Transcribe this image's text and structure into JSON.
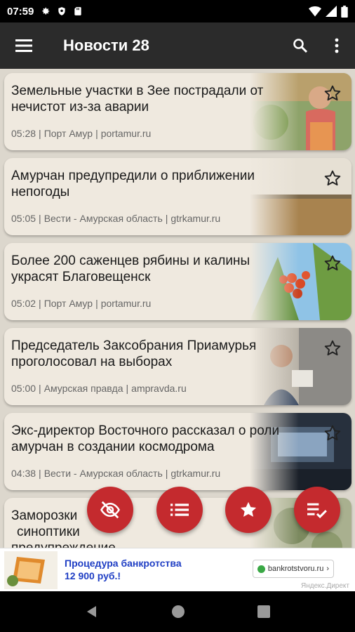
{
  "status": {
    "time": "07:59"
  },
  "appbar": {
    "title": "Новости 28"
  },
  "news": [
    {
      "title_line1": "Земельные участки в Зее пострадали от",
      "title_line2": "нечистот из-за аварии",
      "time": "05:28",
      "source": "Порт Амур",
      "domain": "portamur.ru"
    },
    {
      "title_line1": "Амурчан предупредили о приближении",
      "title_line2": "непогоды",
      "time": "05:05",
      "source": "Вести - Амурская область",
      "domain": "gtrkamur.ru"
    },
    {
      "title_line1": "Более 200 саженцев рябины и калины",
      "title_line2": "украсят Благовещенск",
      "time": "05:02",
      "source": "Порт Амур",
      "domain": "portamur.ru"
    },
    {
      "title_line1": "Председатель Заксобрания Приамурья",
      "title_line2": "проголосовал на выборах",
      "time": "05:00",
      "source": "Амурская правда",
      "domain": "ampravda.ru"
    },
    {
      "title_line1": "Экс-директор Восточного рассказал о роли",
      "title_line2": "амурчан в создании космодрома",
      "time": "04:38",
      "source": "Вести - Амурская область",
      "domain": "gtrkamur.ru"
    },
    {
      "title_line1": "Заморозки",
      "title_line2": "синоптики",
      "title_line3": "предупреждение"
    }
  ],
  "ad": {
    "line1": "Процедура банкротства",
    "line2": "12 900 руб.!",
    "button": "bankrotstvoru.ru",
    "source": "Яндекс.Директ"
  },
  "colors": {
    "fab": "#c42a2e",
    "appbar": "#2b2b2b",
    "background": "#dcd7cd",
    "card": "#efe9df"
  }
}
